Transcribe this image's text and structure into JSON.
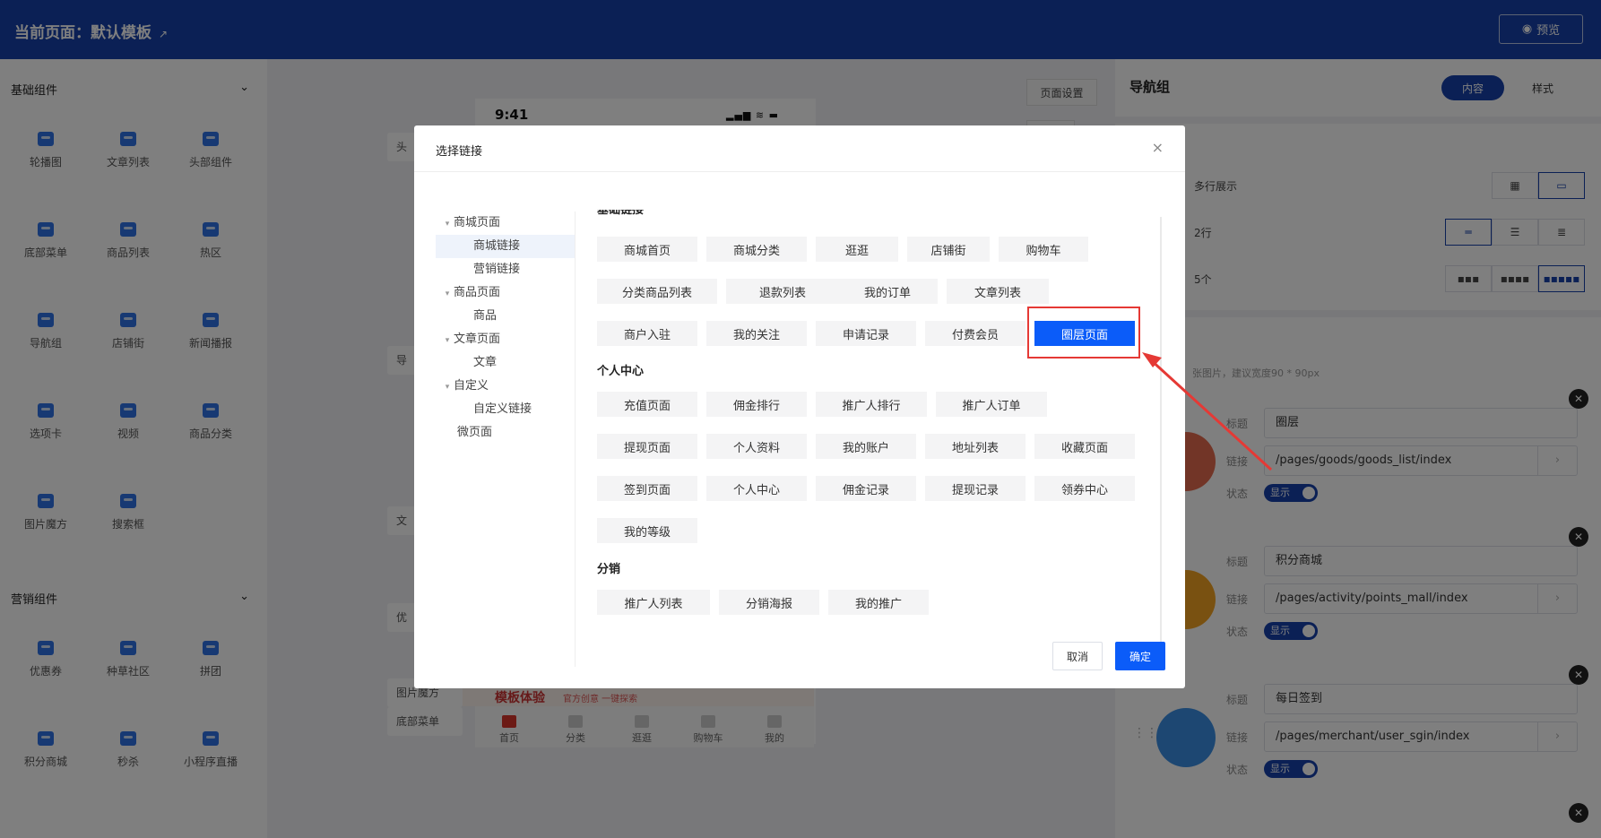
{
  "topbar": {
    "title": "当前页面：默认模板",
    "edit_icon": "↗",
    "preview_icon": "◉",
    "preview_label": "预览"
  },
  "left_sidebar": {
    "sections": [
      {
        "title": "基础组件",
        "chevron": "⌄",
        "items": [
          "轮播图",
          "文章列表",
          "头部组件",
          "底部菜单",
          "商品列表",
          "热区",
          "导航组",
          "店铺街",
          "新闻播报",
          "选项卡",
          "视频",
          "商品分类",
          "图片魔方",
          "搜索框"
        ]
      },
      {
        "title": "营销组件",
        "chevron": "⌄",
        "items": [
          "优惠券",
          "种草社区",
          "拼团",
          "积分商城",
          "秒杀",
          "小程序直播"
        ]
      }
    ]
  },
  "canvas": {
    "page_settings": "页面设置",
    "time": "9:41",
    "status_icons": "▂▄▆ ≋ ▬",
    "left_labels": [
      "头",
      "导",
      "文",
      "优",
      "图片魔方",
      "底部菜单"
    ],
    "banner": {
      "main": "模板体验",
      "sub": "官方创意 一键探索"
    },
    "tabbar": [
      "首页",
      "分类",
      "逛逛",
      "购物车",
      "我的"
    ]
  },
  "right_panel": {
    "title": "导航组",
    "tabs": [
      "内容",
      "样式"
    ],
    "options": [
      {
        "label": "多行展示",
        "choices": [
          "▦",
          "▭"
        ],
        "active": 1
      },
      {
        "label": "2行",
        "choices": [
          "═",
          "☰",
          "≣"
        ],
        "active": 0
      },
      {
        "label": "5个",
        "choices": [
          "▪▪▪",
          "▪▪▪▪",
          "▪▪▪▪▪"
        ],
        "active": 2
      }
    ],
    "hint": "张图片，建议宽度90 * 90px",
    "field_labels": {
      "title": "标题",
      "link": "链接",
      "status": "状态"
    },
    "items": [
      {
        "title": "圈层",
        "link": "/pages/goods/goods_list/index",
        "status": "显示",
        "color": "#e46a4f"
      },
      {
        "title": "积分商城",
        "link": "/pages/activity/points_mall/index",
        "status": "显示",
        "color": "#f3a223"
      },
      {
        "title": "每日签到",
        "link": "/pages/merchant/user_sgin/index",
        "status": "显示",
        "color": "#3b8fe5"
      }
    ],
    "close_icon": "✕",
    "arrow_icon": "›",
    "drag_icon": "⋮⋮"
  },
  "modal": {
    "title": "选择链接",
    "close": "×",
    "tree": [
      {
        "label": "商城页面",
        "level": 0,
        "expanded": true
      },
      {
        "label": "商城链接",
        "level": 1,
        "selected": true
      },
      {
        "label": "营销链接",
        "level": 1
      },
      {
        "label": "商品页面",
        "level": 0,
        "expanded": true
      },
      {
        "label": "商品",
        "level": 1
      },
      {
        "label": "文章页面",
        "level": 0,
        "expanded": true
      },
      {
        "label": "文章",
        "level": 1
      },
      {
        "label": "自定义",
        "level": 0,
        "expanded": true
      },
      {
        "label": "自定义链接",
        "level": 1
      },
      {
        "label": "微页面",
        "level": 0
      }
    ],
    "tree_caret": "▾",
    "sections": [
      {
        "title": "基础链接",
        "rows": [
          [
            "商城首页",
            "商城分类",
            "逛逛",
            "店铺街",
            "购物车"
          ],
          [
            "分类商品列表",
            "退款列表",
            "我的订单",
            "文章列表"
          ],
          [
            "商户入驻",
            "我的关注",
            "申请记录",
            "付费会员",
            "圈层页面"
          ]
        ]
      },
      {
        "title": "个人中心",
        "rows": [
          [
            "充值页面",
            "佣金排行",
            "推广人排行",
            "推广人订单"
          ],
          [
            "提现页面",
            "个人资料",
            "我的账户",
            "地址列表",
            "收藏页面"
          ],
          [
            "签到页面",
            "个人中心",
            "佣金记录",
            "提现记录",
            "领券中心"
          ],
          [
            "我的等级"
          ]
        ]
      },
      {
        "title": "分销",
        "rows": [
          [
            "推广人列表",
            "分销海报",
            "我的推广"
          ]
        ]
      }
    ],
    "selected_link": "圈层页面",
    "cancel": "取消",
    "confirm": "确定"
  }
}
